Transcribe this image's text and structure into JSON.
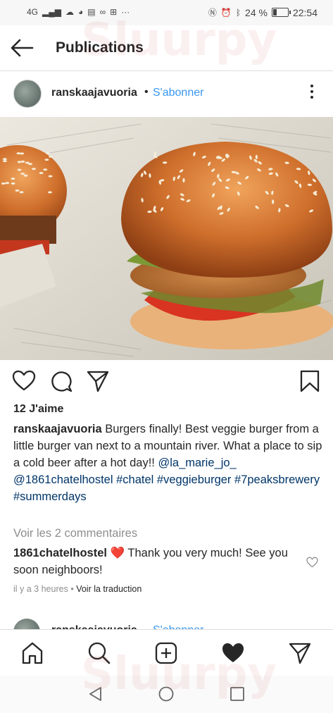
{
  "status_bar": {
    "network": "4G",
    "battery_percent": "24 %",
    "battery_level": 0.24,
    "time": "22:54"
  },
  "app_bar": {
    "title": "Publications"
  },
  "post": {
    "username": "ranskaajavuoria",
    "separator": "•",
    "follow_label": "S'abonner",
    "likes": "12 J'aime",
    "caption": {
      "author": "ranskaajavuoria",
      "text": "Burgers finally! Best veggie burger from a little burger van next to a mountain river. What a place to sip a cold beer after a hot day!!",
      "mentions": [
        "@la_marie_jo_",
        "@1861chatelhostel"
      ],
      "hashtags": [
        "#chatel",
        "#veggieburger",
        "#7peaksbrewery",
        "#summerdays"
      ]
    },
    "view_comments": "Voir les 2 commentaires",
    "comment": {
      "author": "1861chatelhostel",
      "text": "Thank you very much! See you soon neighboors!"
    },
    "time_ago": "il y a 3 heures",
    "meta_separator": "•",
    "translate_label": "Voir la traduction"
  },
  "next_post": {
    "username": "ranskaajavuoria",
    "follow_label": "S'abonner"
  },
  "watermark": "Sluurpy",
  "colors": {
    "accent_blue": "#3897f0",
    "tag_blue": "#003569",
    "heart_red": "#ed4956",
    "text": "#262626",
    "muted": "#8e8e8e"
  }
}
